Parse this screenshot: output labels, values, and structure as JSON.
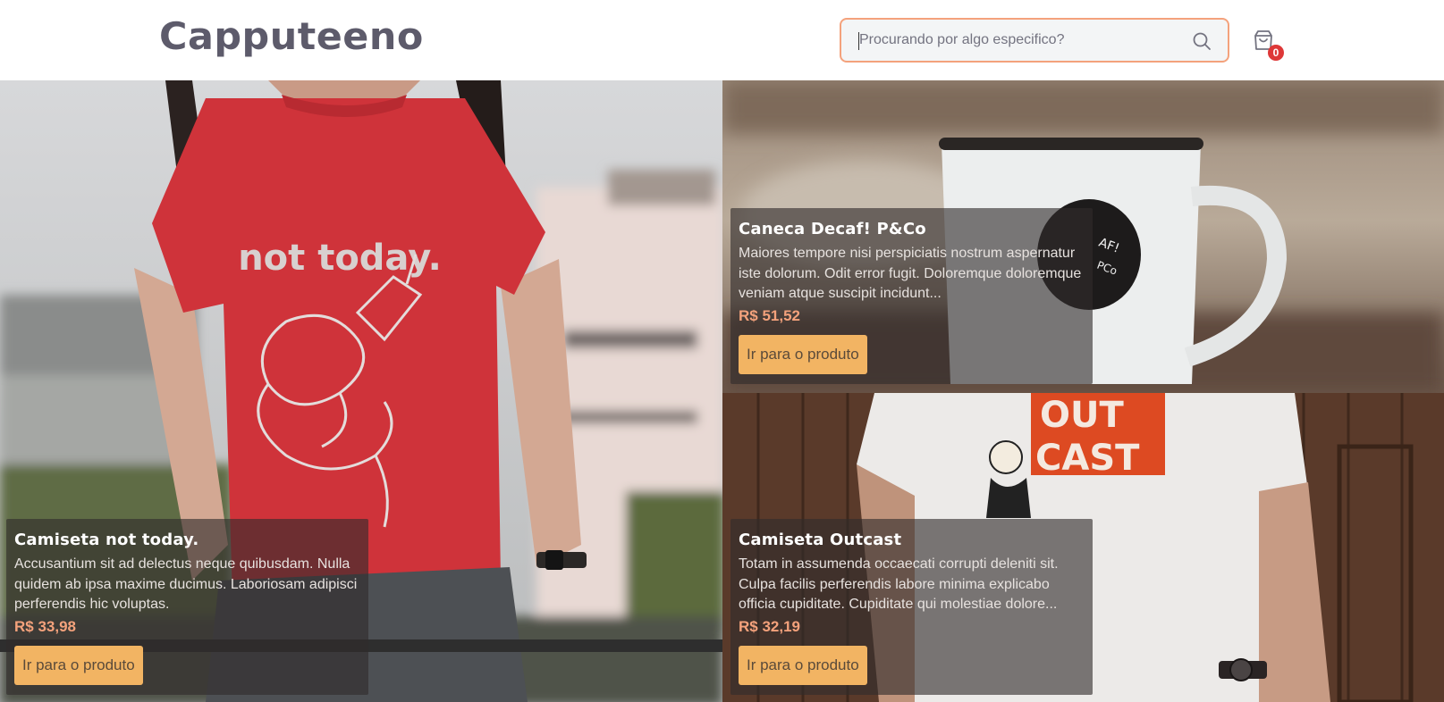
{
  "header": {
    "logo": "Capputeeno",
    "search": {
      "placeholder": "Procurando por algo especifico?"
    },
    "cart": {
      "count": "0"
    }
  },
  "products": [
    {
      "name": "Camiseta not today.",
      "description": "Accusantium sit ad delectus neque quibusdam. Nulla quidem ab ipsa maxime ducimus. Laboriosam adipisci perferendis hic voluptas.",
      "price": "R$ 33,98",
      "button": "Ir para o produto",
      "shirt_print": "not today."
    },
    {
      "name": "Caneca Decaf! P&Co",
      "description": "Maiores tempore nisi perspiciatis nostrum aspernatur iste dolorum. Odit error fugit. Doloremque doloremque veniam atque suscipit incidunt...",
      "price": "R$ 51,52",
      "button": "Ir para o produto"
    },
    {
      "name": "Camiseta Outcast",
      "description": "Totam in assumenda occaecati corrupti deleniti sit. Culpa facilis perferendis labore minima explicabo officia cupiditate. Cupiditate qui molestiae dolore...",
      "price": "R$ 32,19",
      "button": "Ir para o produto",
      "shirt_print_1": "OUT",
      "shirt_print_2": "CAST"
    }
  ],
  "colors": {
    "accent": "#f4a27c",
    "button": "#f2b463",
    "badge": "#de3838",
    "logo": "#5d5b6b"
  }
}
